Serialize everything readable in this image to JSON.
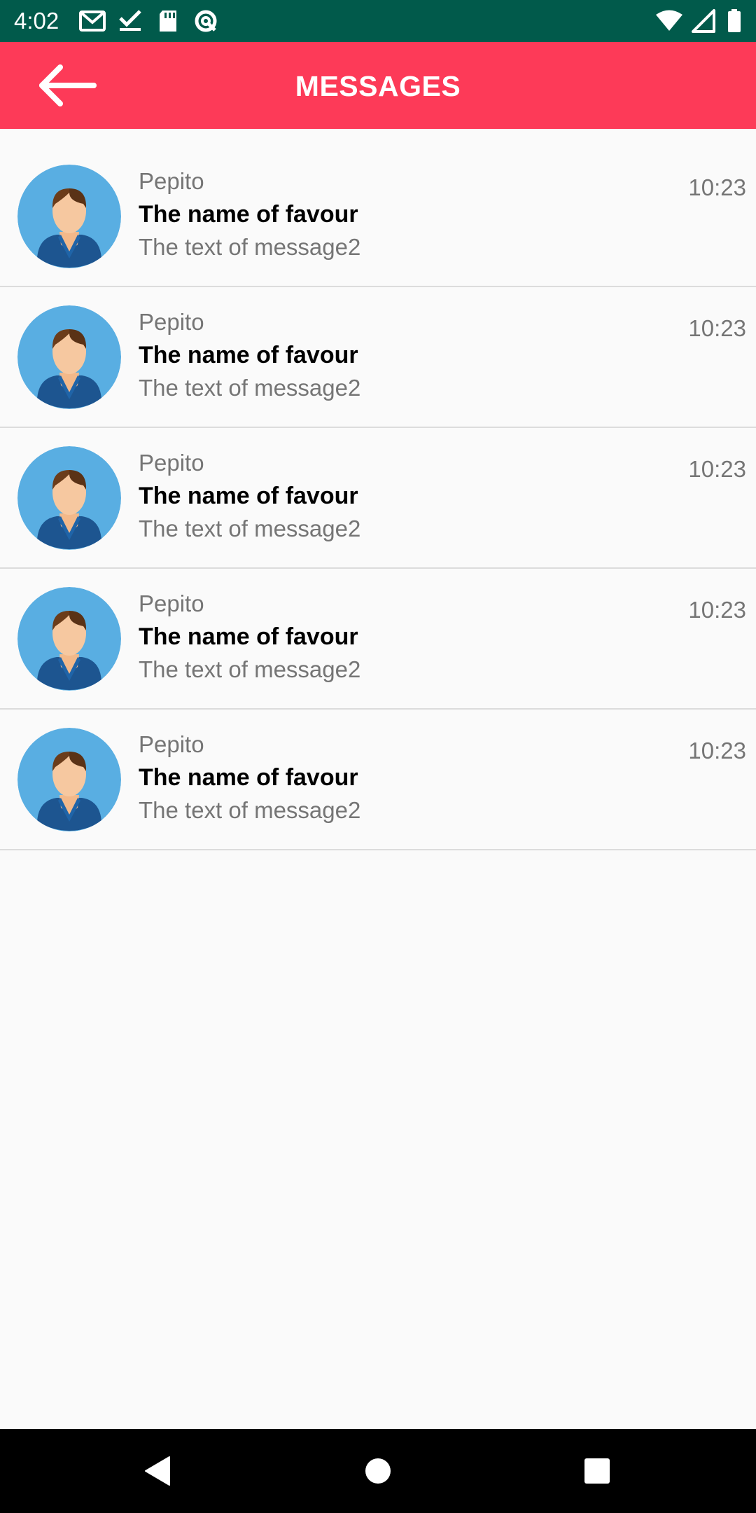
{
  "status_bar": {
    "time": "4:02",
    "left_icons": [
      "gmail-icon",
      "task-done-icon",
      "sd-card-icon",
      "data-saver-icon"
    ],
    "right_icons": [
      "wifi-icon",
      "cell-signal-icon",
      "battery-icon"
    ],
    "background": "#015a4b"
  },
  "app_bar": {
    "title": "MESSAGES",
    "back_icon": "arrow-back-icon",
    "background": "#fd3a58"
  },
  "messages": [
    {
      "sender": "Pepito",
      "subject": "The name of favour",
      "text": "The text of message2",
      "time": "10:23",
      "avatar": "avatar-icon"
    },
    {
      "sender": "Pepito",
      "subject": "The name of favour",
      "text": "The text of message2",
      "time": "10:23",
      "avatar": "avatar-icon"
    },
    {
      "sender": "Pepito",
      "subject": "The name of favour",
      "text": "The text of message2",
      "time": "10:23",
      "avatar": "avatar-icon"
    },
    {
      "sender": "Pepito",
      "subject": "The name of favour",
      "text": "The text of message2",
      "time": "10:23",
      "avatar": "avatar-icon"
    },
    {
      "sender": "Pepito",
      "subject": "The name of favour",
      "text": "The text of message2",
      "time": "10:23",
      "avatar": "avatar-icon"
    }
  ],
  "nav_bar": {
    "buttons": [
      "nav-back-icon",
      "nav-home-icon",
      "nav-recents-icon"
    ]
  }
}
